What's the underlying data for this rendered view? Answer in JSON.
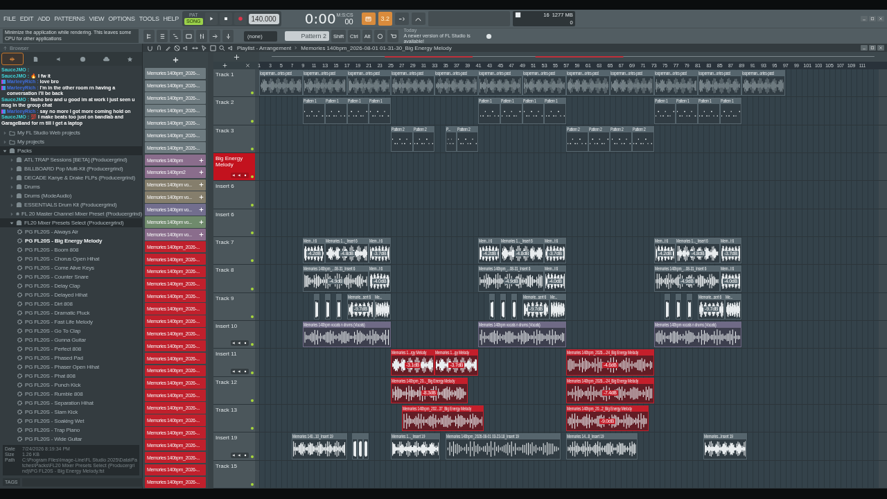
{
  "menu": [
    "FILE",
    "EDIT",
    "ADD",
    "PATTERNS",
    "VIEW",
    "OPTIONS",
    "TOOLS",
    "HELP"
  ],
  "transport": {
    "pat_label": "PAT",
    "song_label": "SONG",
    "song_mode": true,
    "tempo": "140.000",
    "time": "0:00",
    "time_cs": "00",
    "time_unit": "M:S:CS",
    "counter": "3.2"
  },
  "cpu": {
    "voices": "16",
    "memory": "1277 MB",
    "polyphony": "0"
  },
  "hint": "Minimize the application while rendering. This leaves some CPU for other applications",
  "channel_filter": "(none)",
  "pattern": "Pattern 2",
  "modifiers": [
    "Shift",
    "Ctrl",
    "Alt"
  ],
  "news": {
    "label": "Today",
    "text": "A newer version of FL Studio is available!"
  },
  "chat": [
    {
      "user": "SauceJMO :",
      "color": "#3fd3d8",
      "badge": false
    },
    {
      "user": "SauceJMO :",
      "color": "#3fd3d8",
      "badge": false,
      "text": "🔥 I fw it"
    },
    {
      "user": "MarleeyRich :",
      "color": "#3f6fe0",
      "badge": true,
      "text": "love bro"
    },
    {
      "user": "MarleeyRich :",
      "color": "#3f6fe0",
      "badge": true,
      "text": "I'm in the other room rn having a conversation I'll be back"
    },
    {
      "user": "SauceJMO :",
      "color": "#3fd3d8",
      "badge": false,
      "text": "fasho bro and u good im at work I just seen u msg in the group chat"
    },
    {
      "user": "MarleeyRich :",
      "color": "#3f6fe0",
      "badge": true,
      "text": "say no more I got more coming hold on"
    },
    {
      "user": "SauceJMO :",
      "color": "#3fd3d8",
      "badge": false,
      "text": "💯 I make beats too just on bandlab and GarageBand for rn till I get a laptop"
    }
  ],
  "browser": {
    "title": "Browser",
    "tabs": [
      {
        "selected": true
      },
      {
        "selected": false
      },
      {
        "selected": false
      },
      {
        "selected": false
      },
      {
        "selected": false
      },
      {
        "selected": false
      }
    ],
    "items": [
      {
        "kind": "folder",
        "label": "My FL Studio Web projects",
        "expanded": false
      },
      {
        "kind": "folder",
        "label": "My projects",
        "expanded": false
      },
      {
        "kind": "pack",
        "label": "Packs",
        "expanded": true,
        "children": [
          {
            "kind": "pack",
            "label": "ATL TRAP Sessions [BETA] (Producergrind)",
            "expanded": false
          },
          {
            "kind": "pack",
            "label": "BILLBOARD Pop Multi-Kit (Producergrind)",
            "expanded": false
          },
          {
            "kind": "pack",
            "label": "DECADE Kanye & Drake FLPs (Producergrind)",
            "expanded": false
          },
          {
            "kind": "pack",
            "label": "Drums",
            "expanded": false
          },
          {
            "kind": "pack",
            "label": "Drums (ModeAudio)",
            "expanded": false
          },
          {
            "kind": "pack",
            "label": "ESSENTIALS Drum Kit (Producergrind)",
            "expanded": false
          },
          {
            "kind": "pack",
            "label": "FL 20 Master Channel Mixer Preset (Producergrind)",
            "expanded": false
          },
          {
            "kind": "pack",
            "label": "FL20 Mixer Presets Select (Producergrind)",
            "expanded": true,
            "children": [
              {
                "kind": "preset",
                "label": "PG FL20S - Always Air",
                "selected": false
              },
              {
                "kind": "preset",
                "label": "PG FL20S - Big Energy Melody",
                "selected": true
              },
              {
                "kind": "preset",
                "label": "PG FL20S - Boom 808",
                "selected": false
              },
              {
                "kind": "preset",
                "label": "PG FL20S - Chorus Open Hihat",
                "selected": false
              },
              {
                "kind": "preset",
                "label": "PG FL20S - Come Alive Keys",
                "selected": false
              },
              {
                "kind": "preset",
                "label": "PG FL20S - Counter Snare",
                "selected": false
              },
              {
                "kind": "preset",
                "label": "PG FL20S - Delay Clap",
                "selected": false
              },
              {
                "kind": "preset",
                "label": "PG FL20S - Delayed Hihat",
                "selected": false
              },
              {
                "kind": "preset",
                "label": "PG FL20S - Dirt 808",
                "selected": false
              },
              {
                "kind": "preset",
                "label": "PG FL20S - Dramatic Pluck",
                "selected": false
              },
              {
                "kind": "preset",
                "label": "PG FL20S - Fast Life Melody",
                "selected": false
              },
              {
                "kind": "preset",
                "label": "PG FL20S - Go To Clap",
                "selected": false
              },
              {
                "kind": "preset",
                "label": "PG FL20S - Gunna Guitar",
                "selected": false
              },
              {
                "kind": "preset",
                "label": "PG FL20S - Perfect 808",
                "selected": false
              },
              {
                "kind": "preset",
                "label": "PG FL20S - Phased Pad",
                "selected": false
              },
              {
                "kind": "preset",
                "label": "PG FL20S - Phaser Open Hihat",
                "selected": false
              },
              {
                "kind": "preset",
                "label": "PG FL20S - Phat 808",
                "selected": false
              },
              {
                "kind": "preset",
                "label": "PG FL20S - Punch Kick",
                "selected": false
              },
              {
                "kind": "preset",
                "label": "PG FL20S - Rumble 808",
                "selected": false
              },
              {
                "kind": "preset",
                "label": "PG FL20S - Separation Hihat",
                "selected": false
              },
              {
                "kind": "preset",
                "label": "PG FL20S - Slam Kick",
                "selected": false
              },
              {
                "kind": "preset",
                "label": "PG FL20S - Soaking Wet",
                "selected": false
              },
              {
                "kind": "preset",
                "label": "PG FL20S - Trap Piano",
                "selected": false
              },
              {
                "kind": "preset",
                "label": "PG FL20S - Wide Guitar",
                "selected": false
              }
            ]
          }
        ]
      }
    ],
    "info": [
      {
        "label": "Date",
        "value": "7/24/2026 8:19:34 PM"
      },
      {
        "label": "Size",
        "value": "1.26 KB"
      },
      {
        "label": "Path",
        "value": "C:\\Program Files\\Image-Line\\FL Studio 2025\\Data\\Patches\\Packs\\FL20 Mixer Presets Select (Producergrind)\\PG FL20S - Big Energy Melody.fst"
      }
    ],
    "tags_label": "TAGS"
  },
  "playlist": {
    "title": "Playlist - Arrangement",
    "arrangement": "Memories 140bpm_2026-08-01 01-31-30_Big Energy Melody",
    "ruler": [
      "1",
      "3",
      "5",
      "7",
      "9",
      "11",
      "13",
      "15",
      "17",
      "19",
      "21",
      "23",
      "25",
      "27",
      "29",
      "31",
      "33",
      "35",
      "37",
      "39",
      "41",
      "43",
      "45",
      "47",
      "49",
      "51",
      "53",
      "55",
      "57",
      "59",
      "61",
      "63",
      "65",
      "67",
      "69",
      "71",
      "73",
      "75",
      "77",
      "79",
      "81",
      "83",
      "85",
      "87",
      "89",
      "91",
      "93",
      "95",
      "97",
      "99",
      "101",
      "103",
      "105",
      "107",
      "109",
      "111"
    ],
    "channels": [
      {
        "label": "Memories 140bpm_2026-...",
        "color": "#6e7b80",
        "plus": false
      },
      {
        "label": "Memories 140bpm_2026-...",
        "color": "#6e7b80",
        "plus": false
      },
      {
        "label": "Memories 140bpm_2026-...",
        "color": "#6e7b80",
        "plus": false
      },
      {
        "label": "Memories 140bpm_2026-...",
        "color": "#6e7b80",
        "plus": false
      },
      {
        "label": "Memories 140bpm_2026-...",
        "color": "#6e7b80",
        "plus": false
      },
      {
        "label": "Memories 140bpm_2026-...",
        "color": "#6e7b80",
        "plus": false
      },
      {
        "label": "Memories 140bpm_2026-...",
        "color": "#6e7b80",
        "plus": false
      },
      {
        "label": "Memories 140bpm",
        "color": "#8a6d8c",
        "plus": true
      },
      {
        "label": "Memories 140bpm2",
        "color": "#8a6d8c",
        "plus": true
      },
      {
        "label": "Memories 140bpm vo...",
        "color": "#857e6c",
        "plus": true
      },
      {
        "label": "Memories 140bpm vo...",
        "color": "#857e6c",
        "plus": true
      },
      {
        "label": "Memories 140bpm vo...",
        "color": "#726e8e",
        "plus": true
      },
      {
        "label": "Memories 140bpm vo...",
        "color": "#6f8a6c",
        "plus": true
      },
      {
        "label": "Memories 140bpm vo...",
        "color": "#8a6d8c",
        "plus": true
      },
      {
        "label": "Memories 140bpm_2026-...",
        "color": "#c0202c",
        "plus": false
      },
      {
        "label": "Memories 140bpm_2026-...",
        "color": "#c0202c",
        "plus": false
      },
      {
        "label": "Memories 140bpm_2026-...",
        "color": "#c0202c",
        "plus": false
      },
      {
        "label": "Memories 140bpm_2026-...",
        "color": "#c0202c",
        "plus": false
      },
      {
        "label": "Memories 140bpm_2026-...",
        "color": "#c0202c",
        "plus": false
      },
      {
        "label": "Memories 140bpm_2026-...",
        "color": "#c0202c",
        "plus": false
      },
      {
        "label": "Memories 140bpm_2026-...",
        "color": "#c0202c",
        "plus": false
      },
      {
        "label": "Memories 140bpm_2026-...",
        "color": "#c0202c",
        "plus": false
      },
      {
        "label": "Memories 140bpm_2026-...",
        "color": "#c0202c",
        "plus": false
      },
      {
        "label": "Memories 140bpm_2026-...",
        "color": "#c0202c",
        "plus": false
      },
      {
        "label": "Memories 140bpm_2026-...",
        "color": "#c0202c",
        "plus": false
      },
      {
        "label": "Memories 140bpm_2026-...",
        "color": "#c0202c",
        "plus": false
      },
      {
        "label": "Memories 140bpm_2026-...",
        "color": "#c0202c",
        "plus": false
      },
      {
        "label": "Memories 140bpm_2026-...",
        "color": "#c0202c",
        "plus": false
      },
      {
        "label": "Memories 140bpm_2026-...",
        "color": "#c0202c",
        "plus": false
      },
      {
        "label": "Memories 140bpm_2026-...",
        "color": "#c0202c",
        "plus": false
      },
      {
        "label": "Memories 140bpm_2026-...",
        "color": "#c0202c",
        "plus": false
      },
      {
        "label": "Memories 140bpm_2026-...",
        "color": "#c0202c",
        "plus": false
      },
      {
        "label": "Memories 140bpm_2026-...",
        "color": "#c0202c",
        "plus": false
      },
      {
        "label": "Memories 140bpm_2026-...",
        "color": "#c0202c",
        "plus": false
      }
    ],
    "tracks": [
      {
        "name": "Track 1",
        "kind": "plain",
        "selected": false,
        "clips": [
          {
            "kind": "audio",
            "label": "looperman...ories-past",
            "color": "#56656d"
          },
          {
            "kind": "audio",
            "label": "looperman...ories-past",
            "color": "#56656d"
          },
          {
            "kind": "audio",
            "label": "looperman...ories-past",
            "color": "#56656d"
          },
          {
            "kind": "audio",
            "label": "looperman...ories-past",
            "color": "#56656d"
          },
          {
            "kind": "audio",
            "label": "looperman...ories-past",
            "color": "#56656d"
          },
          {
            "kind": "audio",
            "label": "looperman...ories-past",
            "color": "#56656d"
          },
          {
            "kind": "audio",
            "label": "looperman...ories-past",
            "color": "#56656d"
          },
          {
            "kind": "audio",
            "label": "looperman...ories-past",
            "color": "#56656d"
          },
          {
            "kind": "audio",
            "label": "looperman...ories-past",
            "color": "#56656d"
          },
          {
            "kind": "audio",
            "label": "looperman...ories-past",
            "color": "#56656d"
          },
          {
            "kind": "audio",
            "label": "looperman...ories-past",
            "color": "#56656d"
          },
          {
            "kind": "audio",
            "label": "looperman...ories-past",
            "color": "#56656d"
          }
        ]
      },
      {
        "name": "Track 2",
        "kind": "plain",
        "selected": false,
        "clips": [
          {
            "kind": "pattern",
            "label": "Pattern 1",
            "color": "#56656d"
          },
          {
            "kind": "pattern",
            "label": "Pattern 1",
            "color": "#56656d"
          },
          {
            "kind": "pattern",
            "label": "Pattern 1",
            "color": "#56656d"
          },
          {
            "kind": "pattern",
            "label": "Pattern 1",
            "color": "#56656d"
          },
          {
            "kind": "pattern",
            "label": "Pattern 1",
            "color": "#56656d"
          },
          {
            "kind": "pattern",
            "label": "Pattern 1",
            "color": "#56656d"
          },
          {
            "kind": "pattern",
            "label": "Pattern 1",
            "color": "#56656d"
          },
          {
            "kind": "pattern",
            "label": "Pattern 1",
            "color": "#56656d"
          },
          {
            "kind": "pattern",
            "label": "Pattern 1",
            "color": "#56656d"
          },
          {
            "kind": "pattern",
            "label": "Pattern 1",
            "color": "#56656d"
          },
          {
            "kind": "pattern",
            "label": "Pattern 1",
            "color": "#56656d"
          },
          {
            "kind": "pattern",
            "label": "Pattern 1",
            "color": "#56656d"
          }
        ]
      },
      {
        "name": "Track 3",
        "kind": "plain",
        "selected": false,
        "clips": [
          {
            "kind": "pattern",
            "label": "Pattern 2",
            "color": "#56656d"
          },
          {
            "kind": "pattern",
            "label": "Pattern 2",
            "color": "#56656d"
          },
          {
            "kind": "pattern",
            "label": "P...",
            "color": "#56656d"
          },
          {
            "kind": "pattern",
            "label": "Pattern 2",
            "color": "#56656d"
          },
          {
            "kind": "pattern",
            "label": "Pattern 2",
            "color": "#56656d"
          },
          {
            "kind": "pattern",
            "label": "Pattern 2",
            "color": "#56656d"
          },
          {
            "kind": "pattern",
            "label": "Pattern 2",
            "color": "#56656d"
          },
          {
            "kind": "pattern",
            "label": "Pattern 2",
            "color": "#56656d"
          }
        ]
      },
      {
        "name": "Big Energy Melody",
        "kind": "insert",
        "selected": true
      },
      {
        "name": "Insert 6",
        "kind": "plain",
        "selected": false
      },
      {
        "name": "Insert 6",
        "kind": "plain",
        "selected": false
      },
      {
        "name": "Track 7",
        "kind": "plain",
        "selected": false,
        "clips": [
          {
            "kind": "audio",
            "label": "Mem...t 6",
            "color": "#56656d",
            "gains": [
              "-4.2dB"
            ]
          },
          {
            "kind": "audio",
            "label": "Memories 1..._Insert 6",
            "color": "#56656d",
            "gains": [
              "-4.8dB"
            ]
          },
          {
            "kind": "audio",
            "label": "Mem...t 6",
            "color": "#56656d",
            "gains": [
              "-3.7dB"
            ]
          },
          {
            "kind": "audio",
            "label": "Mem...t 6",
            "color": "#56656d",
            "gains": [
              "-4.2dB"
            ]
          },
          {
            "kind": "audio",
            "label": "Memories 1..._Insert 6",
            "color": "#56656d",
            "gains": [
              "-4.8dB"
            ]
          },
          {
            "kind": "audio",
            "label": "Mem...t 6",
            "color": "#56656d",
            "gains": [
              "-3.7dB"
            ]
          },
          {
            "kind": "audio",
            "label": "Mem...t 6",
            "color": "#56656d",
            "gains": [
              "-4.2dB"
            ]
          },
          {
            "kind": "audio",
            "label": "Memories 1..._Insert 6",
            "color": "#56656d",
            "gains": [
              "-4.8dB"
            ]
          },
          {
            "kind": "audio",
            "label": "Mem...t 6",
            "color": "#56656d",
            "gains": [
              "-3.7dB"
            ]
          }
        ]
      },
      {
        "name": "Track 8",
        "kind": "plain",
        "selected": false,
        "clips": [
          {
            "kind": "audio",
            "label": "Memories 140bpm_...08-31_Insert 6",
            "color": "#56656d",
            "gains": [
              "-4.9dB"
            ]
          },
          {
            "kind": "audio",
            "label": "Mem...t 6",
            "color": "#56656d",
            "gains": [
              "-4.0dB"
            ]
          },
          {
            "kind": "audio",
            "label": "Memories 140bpm_...08-31_Insert 6",
            "color": "#56656d",
            "gains": [
              "-4.9dB"
            ]
          },
          {
            "kind": "audio",
            "label": "Mem...t 6",
            "color": "#56656d",
            "gains": [
              "-4.0dB"
            ]
          },
          {
            "kind": "audio",
            "label": "Memories 140bpm_...08-31_Insert 6",
            "color": "#56656d",
            "gains": [
              "-4.9dB"
            ]
          },
          {
            "kind": "audio",
            "label": "Mem...t 6",
            "color": "#56656d",
            "gains": [
              "-4.0dB"
            ]
          }
        ]
      },
      {
        "name": "Track 9",
        "kind": "plain",
        "selected": false,
        "clips": [
          {
            "kind": "audio",
            "color": "#56656d"
          },
          {
            "kind": "audio",
            "color": "#56656d"
          },
          {
            "kind": "audio",
            "color": "#56656d"
          },
          {
            "kind": "audio",
            "label": "Memorie...sert 6",
            "color": "#56656d",
            "gains": [
              "-9.7dB"
            ]
          },
          {
            "kind": "audio",
            "label": "Me...",
            "color": "#56656d"
          },
          {
            "kind": "audio",
            "color": "#56656d"
          },
          {
            "kind": "audio",
            "color": "#56656d"
          },
          {
            "kind": "audio",
            "color": "#56656d"
          },
          {
            "kind": "audio",
            "label": "Memorie...sert 6",
            "color": "#56656d",
            "gains": [
              "-9.7dB"
            ]
          },
          {
            "kind": "audio",
            "label": "Me...",
            "color": "#56656d"
          },
          {
            "kind": "audio",
            "color": "#56656d"
          },
          {
            "kind": "audio",
            "color": "#56656d"
          },
          {
            "kind": "audio",
            "color": "#56656d"
          },
          {
            "kind": "audio",
            "label": "Memorie...sert 6",
            "color": "#56656d",
            "gains": [
              "-9.7dB"
            ]
          },
          {
            "kind": "audio",
            "label": "Me...",
            "color": "#56656d"
          }
        ]
      },
      {
        "name": "Insert 10",
        "kind": "insert",
        "selected": false,
        "clips": [
          {
            "kind": "audio",
            "label": "Memories 140bpm vocals n drums (Vocals)",
            "color": "#6f6a86"
          },
          {
            "kind": "audio",
            "label": "Memories 140bpm vocals n drums (Vocals)",
            "color": "#6f6a86"
          },
          {
            "kind": "audio",
            "label": "Memories 140bpm vocals n drums (Vocals)",
            "color": "#6f6a86"
          }
        ]
      },
      {
        "name": "Insert 11",
        "kind": "insert",
        "selected": false,
        "clips": [
          {
            "kind": "audio",
            "label": "Memories 1...rgy Melody",
            "color": "#c41f2b",
            "gains": [
              "-3.1dB"
            ]
          },
          {
            "kind": "audio",
            "label": "Memories 1...gy Melody",
            "color": "#c41f2b",
            "gains": [
              "-3.7dB"
            ]
          },
          {
            "kind": "audio",
            "label": "Memories 140bpm_2026...-24_Big Energy Melody",
            "color": "#c41f2b",
            "gains": [
              "-4.6dB"
            ]
          }
        ]
      },
      {
        "name": "Track 12",
        "kind": "plain",
        "selected": false,
        "clips": [
          {
            "kind": "audio",
            "label": "Memories 140bpm_20..._Big Energy Melody",
            "color": "#c41f2b",
            "gains": [
              "-8.3dB"
            ]
          },
          {
            "kind": "audio",
            "label": "Memories 140bpm_2026...-24_Big Energy Melody",
            "color": "#c41f2b",
            "gains": [
              "-7.4dB"
            ]
          }
        ]
      },
      {
        "name": "Track 13",
        "kind": "plain",
        "selected": false,
        "clips": [
          {
            "kind": "audio",
            "label": "Memories 140bpm_202...37_Big Energy Melody",
            "color": "#c41f2b"
          },
          {
            "kind": "audio",
            "label": "Memories 140bpm_20...2_Big Energy Melody",
            "color": "#c41f2b",
            "gains": [
              "-9.0dB"
            ]
          }
        ]
      },
      {
        "name": "Insert 19",
        "kind": "insert",
        "selected": false,
        "clips": [
          {
            "kind": "audio",
            "label": "Memories 140...10_Insert 19",
            "color": "#56656d"
          },
          {
            "kind": "audio",
            "color": "#56656d"
          },
          {
            "kind": "audio",
            "color": "#56656d"
          },
          {
            "kind": "audio",
            "color": "#56656d"
          },
          {
            "kind": "audio",
            "label": "Memories 1..._Insert 19",
            "color": "#56656d"
          },
          {
            "kind": "audio",
            "label": "Memories 140bpm_2026-08-01 03-23-18_Insert 19",
            "color": "#56656d"
          },
          {
            "kind": "audio",
            "label": "Memories 14...8_Insert 19",
            "color": "#56656d"
          },
          {
            "kind": "audio",
            "label": "Memories...Insert 19",
            "color": "#56656d"
          }
        ]
      },
      {
        "name": "Track 15",
        "kind": "plain",
        "selected": false
      }
    ]
  }
}
